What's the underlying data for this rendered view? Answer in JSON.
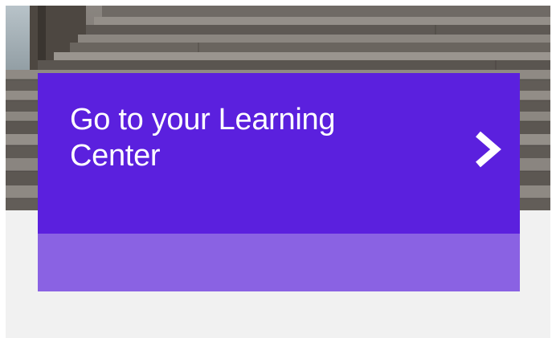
{
  "hero": {
    "image_icon": "wooden-dock-photo"
  },
  "card": {
    "title": "Go to your Learning Center",
    "arrow_icon": "chevron-right-icon",
    "colors": {
      "primary": "#5b20de",
      "secondary": "#8a62e3",
      "text": "#ffffff"
    }
  }
}
